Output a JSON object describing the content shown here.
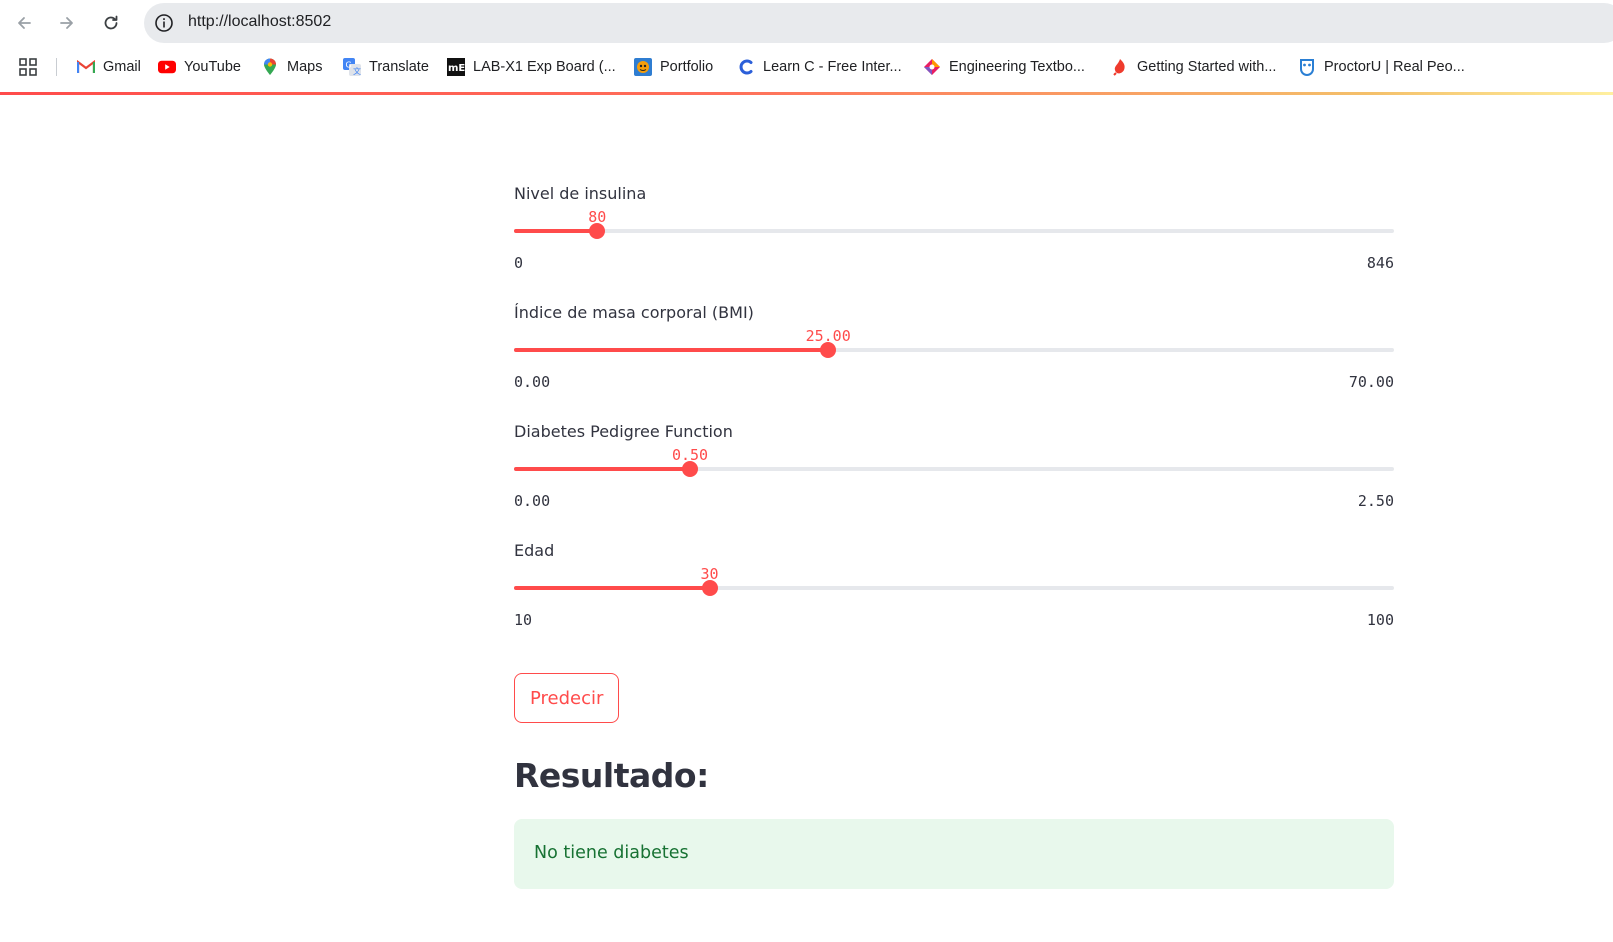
{
  "browser": {
    "url": "http://localhost:8502",
    "bookmarks": [
      {
        "label": "Gmail",
        "icon": "gmail-icon"
      },
      {
        "label": "YouTube",
        "icon": "youtube-icon"
      },
      {
        "label": "Maps",
        "icon": "maps-icon"
      },
      {
        "label": "Translate",
        "icon": "translate-icon"
      },
      {
        "label": "LAB-X1 Exp Board (...",
        "icon": "me-icon"
      },
      {
        "label": "Portfolio",
        "icon": "portfolio-icon"
      },
      {
        "label": "Learn C - Free Inter...",
        "icon": "learn-c-icon"
      },
      {
        "label": "Engineering Textbo...",
        "icon": "engineering-icon"
      },
      {
        "label": "Getting Started with...",
        "icon": "getting-started-icon"
      },
      {
        "label": "ProctorU | Real Peo...",
        "icon": "proctoru-icon"
      }
    ]
  },
  "sliders": [
    {
      "label": "Nivel de insulina",
      "value": "80",
      "min": "0",
      "max": "846",
      "fraction": 0.0946
    },
    {
      "label": "Índice de masa corporal (BMI)",
      "value": "25.00",
      "min": "0.00",
      "max": "70.00",
      "fraction": 0.357
    },
    {
      "label": "Diabetes Pedigree Function",
      "value": "0.50",
      "min": "0.00",
      "max": "2.50",
      "fraction": 0.2
    },
    {
      "label": "Edad",
      "value": "30",
      "min": "10",
      "max": "100",
      "fraction": 0.2222
    }
  ],
  "predict_button": {
    "label": "Predecir"
  },
  "result": {
    "title": "Resultado:",
    "message": "No tiene diabetes"
  },
  "colors": {
    "accent": "#ff4b4b",
    "track": "#e6e8ec",
    "success_bg": "#e8f8ec",
    "success_text": "#177233"
  }
}
